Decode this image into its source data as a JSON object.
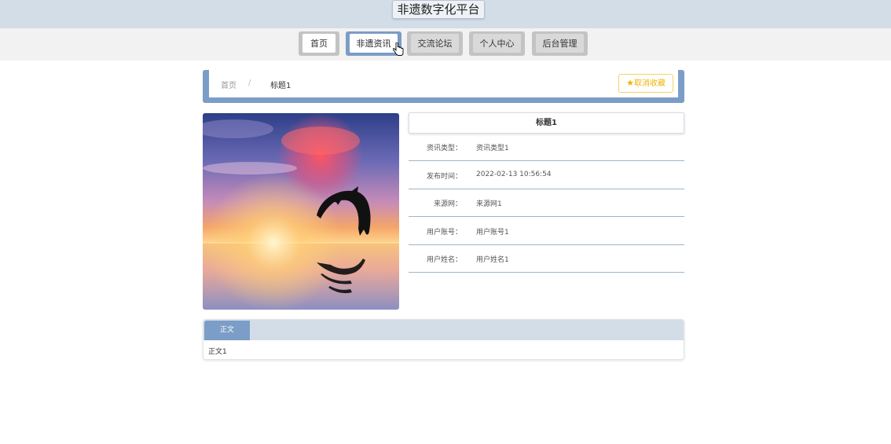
{
  "header": {
    "site_title": "非遗数字化平台"
  },
  "nav": [
    {
      "label": "首页",
      "state": "inactive"
    },
    {
      "label": "非遗资讯",
      "state": "active"
    },
    {
      "label": "交流论坛",
      "state": "inactive"
    },
    {
      "label": "个人中心",
      "state": "inactive"
    },
    {
      "label": "后台管理",
      "state": "inactive"
    }
  ],
  "breadcrumb": {
    "home": "首页",
    "separator": "/",
    "current": "标题1"
  },
  "favorite_button": {
    "label": "取消收藏",
    "icon": "star-icon",
    "color": "#f0b400"
  },
  "detail": {
    "title": "标题1",
    "rows": [
      {
        "label": "资讯类型：",
        "value": "资讯类型1"
      },
      {
        "label": "发布时间：",
        "value": "2022-02-13 10:56:54"
      },
      {
        "label": "来源网：",
        "value": "来源网1"
      },
      {
        "label": "用户账号：",
        "value": "用户账号1"
      },
      {
        "label": "用户姓名：",
        "value": "用户姓名1"
      }
    ]
  },
  "content": {
    "tab_label": "正文",
    "text": "正文1"
  },
  "colors": {
    "accent": "#7b9dc7",
    "header_bg": "#d3dde8",
    "star": "#f0b400"
  }
}
